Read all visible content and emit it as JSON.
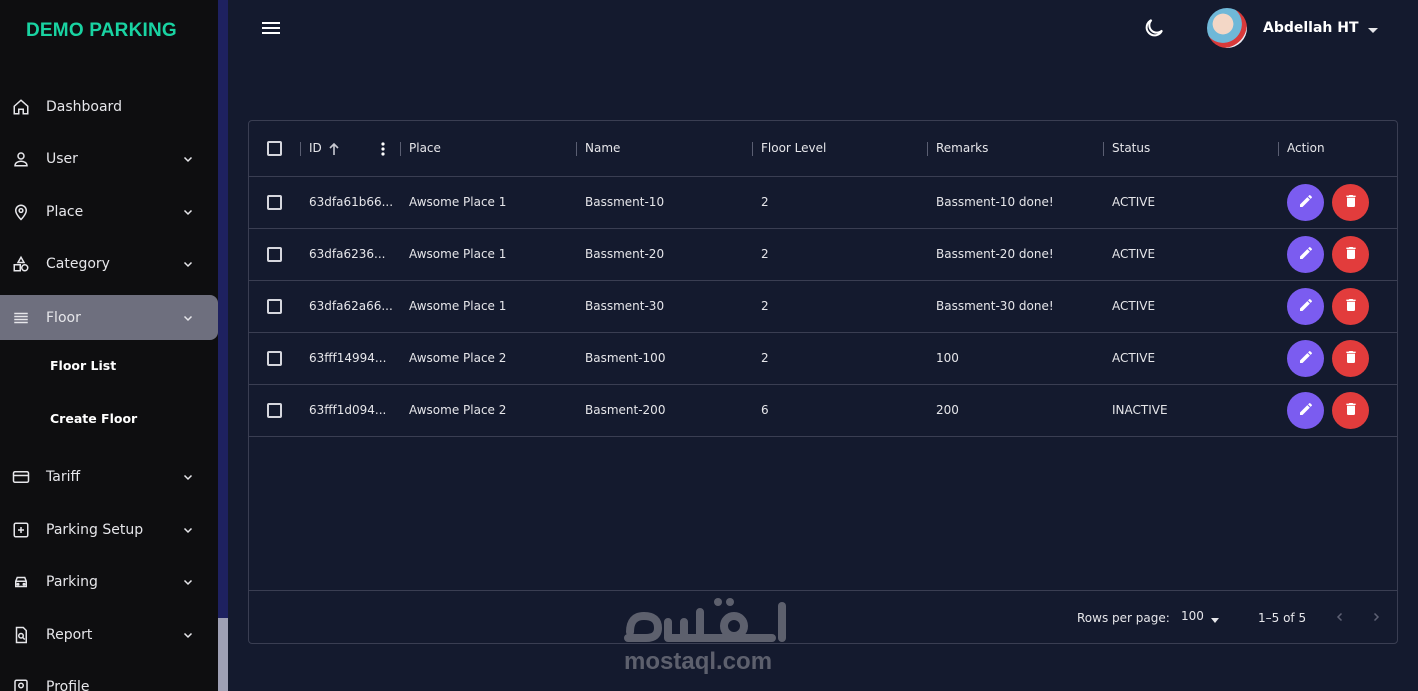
{
  "app": {
    "brand": "DEMO PARKING"
  },
  "sidebar": {
    "items": [
      {
        "label": "Dashboard",
        "icon": "home-icon"
      },
      {
        "label": "User",
        "icon": "person-icon"
      },
      {
        "label": "Place",
        "icon": "location-pin-icon"
      },
      {
        "label": "Category",
        "icon": "category-shapes-icon"
      },
      {
        "label": "Floor",
        "icon": "list-lines-icon",
        "active": true
      },
      {
        "label": "Tariff",
        "icon": "card-icon"
      },
      {
        "label": "Parking Setup",
        "icon": "add-box-icon"
      },
      {
        "label": "Parking",
        "icon": "car-icon"
      },
      {
        "label": "Report",
        "icon": "document-search-icon"
      },
      {
        "label": "Profile",
        "icon": "profile-badge-icon"
      }
    ],
    "floor_subitems": [
      "Floor List",
      "Create Floor"
    ]
  },
  "topbar": {
    "menu_icon": "hamburger-menu-icon",
    "theme_icon": "moon-icon",
    "user_name": "Abdellah HT"
  },
  "table": {
    "columns": [
      "ID",
      "Place",
      "Name",
      "Floor Level",
      "Remarks",
      "Status",
      "Action"
    ],
    "rows": [
      {
        "id": "63dfa61b66...",
        "place": "Awsome Place 1",
        "name": "Bassment-10",
        "floor_level": "2",
        "remarks": "Bassment-10 done!",
        "status": "ACTIVE"
      },
      {
        "id": "63dfa6236...",
        "place": "Awsome Place 1",
        "name": "Bassment-20",
        "floor_level": "2",
        "remarks": "Bassment-20 done!",
        "status": "ACTIVE"
      },
      {
        "id": "63dfa62a66...",
        "place": "Awsome Place 1",
        "name": "Bassment-30",
        "floor_level": "2",
        "remarks": "Bassment-30 done!",
        "status": "ACTIVE"
      },
      {
        "id": "63fff14994...",
        "place": "Awsome Place 2",
        "name": "Basment-100",
        "floor_level": "2",
        "remarks": "100",
        "status": "ACTIVE"
      },
      {
        "id": "63fff1d094...",
        "place": "Awsome Place 2",
        "name": "Basment-200",
        "floor_level": "6",
        "remarks": "200",
        "status": "INACTIVE"
      }
    ]
  },
  "pagination": {
    "rows_per_page_label": "Rows per page:",
    "rows_per_page": "100",
    "range": "1–5 of 5"
  },
  "watermark": {
    "text": "mostaql.com"
  },
  "colors": {
    "brand": "#19d3a2",
    "edit": "#7b5cf0",
    "delete": "#e23c3c",
    "background": "#141a2e"
  }
}
